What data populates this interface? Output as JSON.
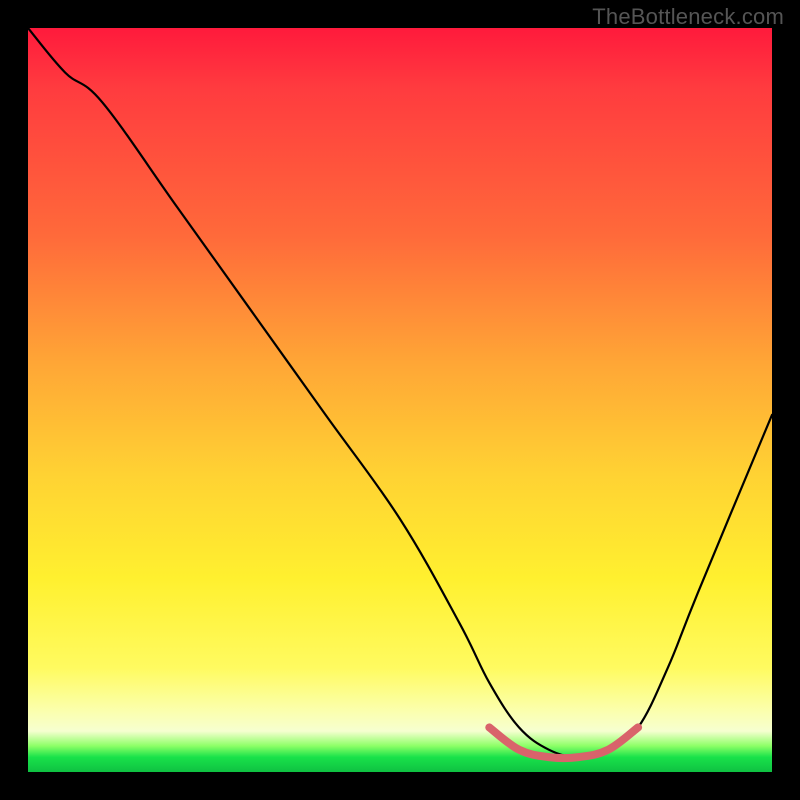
{
  "watermark": "TheBottleneck.com",
  "chart_data": {
    "type": "line",
    "title": "",
    "xlabel": "",
    "ylabel": "",
    "xlim": [
      0,
      100
    ],
    "ylim": [
      0,
      100
    ],
    "grid": false,
    "series": [
      {
        "name": "bottleneck-curve",
        "color": "#000000",
        "x": [
          0,
          5,
          10,
          20,
          30,
          40,
          50,
          58,
          62,
          66,
          70,
          74,
          78,
          82,
          86,
          90,
          100
        ],
        "y": [
          100,
          94,
          90,
          76,
          62,
          48,
          34,
          20,
          12,
          6,
          3,
          2,
          3,
          6,
          14,
          24,
          48
        ]
      },
      {
        "name": "optimal-range-marker",
        "color": "#d9636b",
        "x": [
          62,
          66,
          70,
          74,
          78,
          82
        ],
        "y": [
          6,
          3,
          2,
          2,
          3,
          6
        ]
      }
    ],
    "annotations": []
  },
  "colors": {
    "gradient_top": "#ff1a3c",
    "gradient_mid": "#ffd233",
    "gradient_bottom": "#0fc142",
    "curve": "#000000",
    "optimal_marker": "#d9636b",
    "frame": "#000000"
  }
}
